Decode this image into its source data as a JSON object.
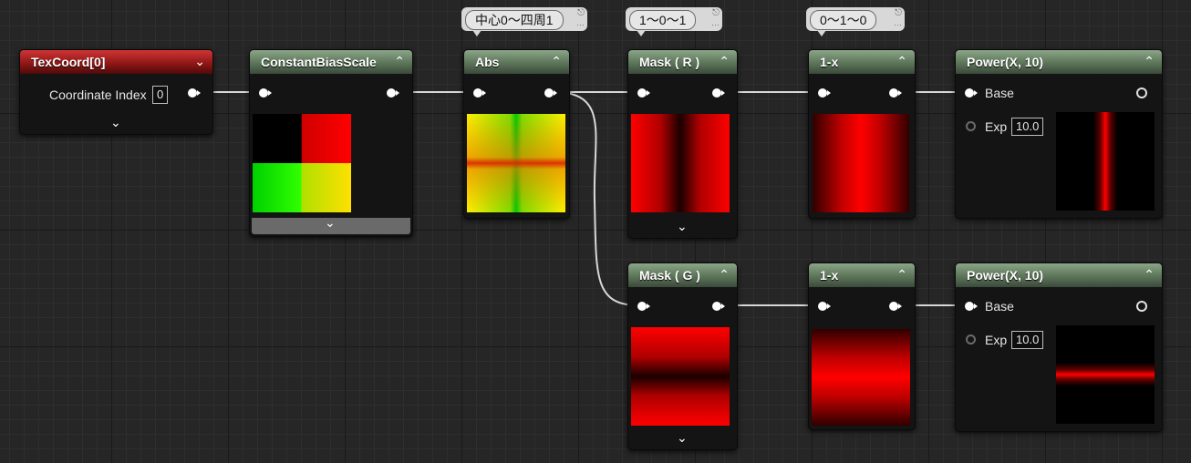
{
  "nodes": {
    "texcoord": {
      "title": "TexCoord[0]",
      "input_label": "Coordinate Index",
      "input_value": "0"
    },
    "cbs": {
      "title": "ConstantBiasScale"
    },
    "abs": {
      "title": "Abs",
      "comment": "中心0～四周1"
    },
    "mask_r": {
      "title": "Mask ( R )",
      "comment": "1～0～1"
    },
    "one_minus_top": {
      "title": "1-x",
      "comment": "0～1～0"
    },
    "power_top": {
      "title": "Power(X, 10)",
      "base_label": "Base",
      "exp_label": "Exp",
      "exp_value": "10.0"
    },
    "mask_g": {
      "title": "Mask ( G )"
    },
    "one_minus_bottom": {
      "title": "1-x"
    },
    "power_bottom": {
      "title": "Power(X, 10)",
      "base_label": "Base",
      "exp_label": "Exp",
      "exp_value": "10.0"
    }
  },
  "icons": {
    "collapse": "chevron-up-icon",
    "expand": "chevron-down-icon",
    "comment_pin": "pin-icon",
    "comment_more": "ellipsis-icon"
  },
  "colors": {
    "canvas": "#262626",
    "header_material": "#5c7559",
    "header_texcoord": "#921717",
    "wire": "#d8d8d8"
  }
}
